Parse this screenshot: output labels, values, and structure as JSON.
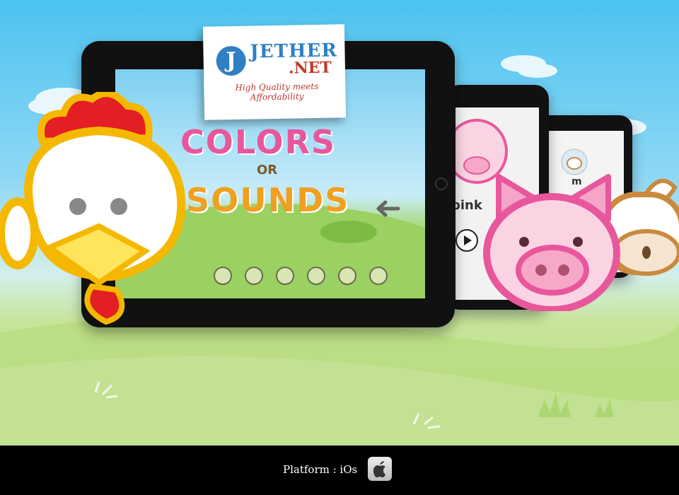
{
  "brand": {
    "letter": "J",
    "name_part1": "JETHER",
    "name_part2": ".NET",
    "tagline": "High Quality meets Affordability"
  },
  "app_title": {
    "word1": "COLORS",
    "word2": "OR",
    "word3": "SOUNDS"
  },
  "secondary_screen": {
    "label": "pink",
    "label2": "m"
  },
  "footer": {
    "platform_text": "Platform : iOs",
    "platform_icon": "apple-icon"
  },
  "colors": {
    "sky": "#4cc3f0",
    "grass": "#b6db7c",
    "chicken_outline": "#f5b800",
    "pig_outline": "#e8579c",
    "cow_outline": "#c98a3e",
    "footer_bg": "#000000"
  }
}
